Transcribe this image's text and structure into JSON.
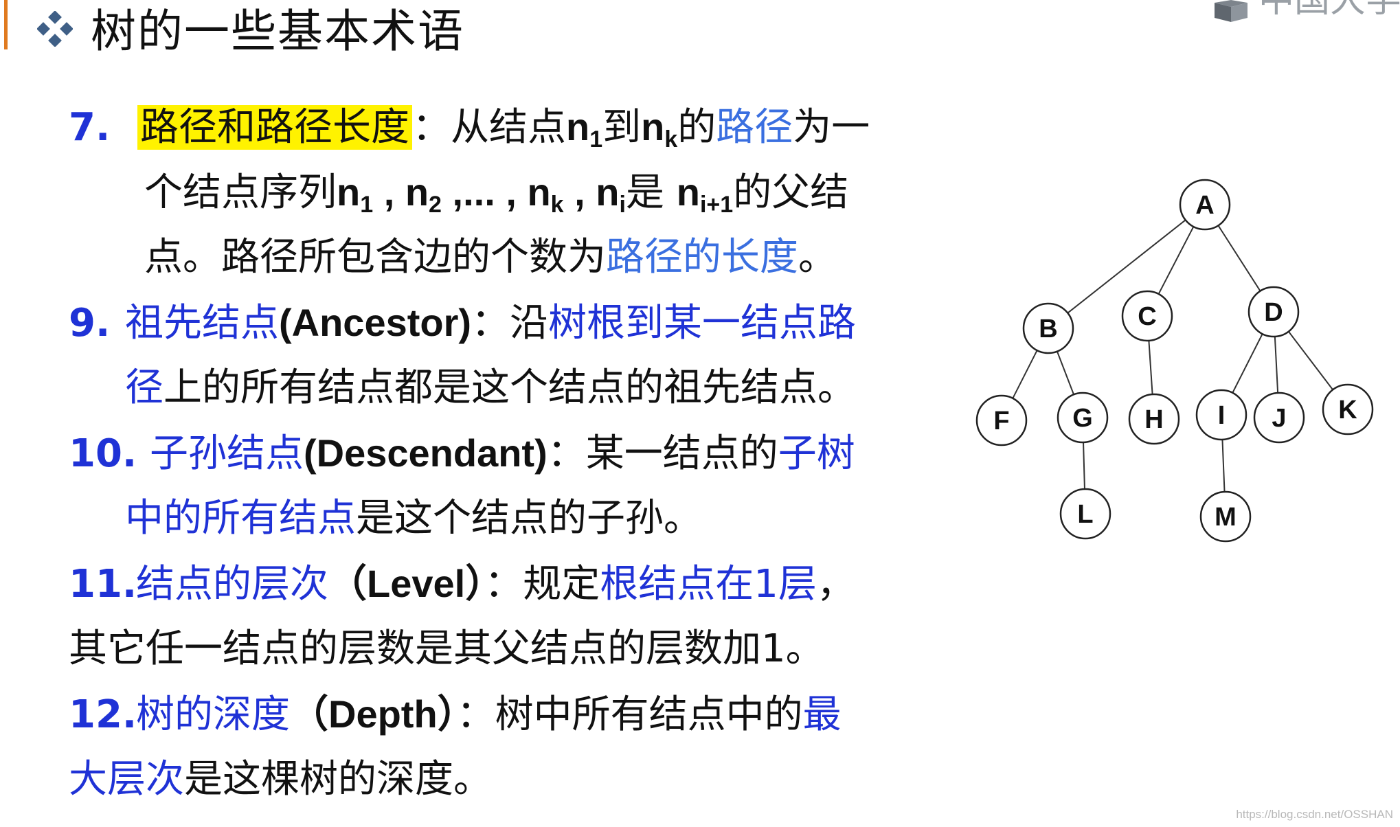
{
  "slide": {
    "title": "树的一些基本术语",
    "watermark": "中国大学MOOC",
    "credit": "https://blog.csdn.net/OSSHAN"
  },
  "terms": {
    "t7": {
      "num": "7.",
      "term": "路径和路径长度",
      "colon": "：",
      "l1_a": "从结点",
      "n1": "n",
      "n1_sub": "1",
      "to": "到",
      "nk": "n",
      "nk_sub": "k",
      "of": "的",
      "path": "路径",
      "l1_b": "为一",
      "l2_a": "个结点序列",
      "s1": "n",
      "s1_sub": "1",
      "sep1": " , ",
      "s2": "n",
      "s2_sub": "2",
      "sep2": " ,... , ",
      "s3": "n",
      "s3_sub": "k",
      "sep3": " , ",
      "s4": "n",
      "s4_sub": "i",
      "is": "是 ",
      "s5": "n",
      "s5_sub": "i+1",
      "l2_b": "的父结",
      "l3_a": "点。路径所包含边的个数为",
      "path_len": "路径的长度",
      "l3_b": "。"
    },
    "t9": {
      "num": "9.",
      "term": "祖先结点",
      "en": "(Ancestor)",
      "colon": "：",
      "l1_a": "沿",
      "l1_b": "树根到某一结点路",
      "l2_a": "径",
      "l2_b": "上的所有结点都是这个结点的祖先结点。"
    },
    "t10": {
      "num": "10.",
      "term": "子孙结点",
      "en": "(Descendant)",
      "colon": "：",
      "l1_a": "某一结点的",
      "l1_b": "子树",
      "l2_a": "中的所有结点",
      "l2_b": "是这个结点的子孙。"
    },
    "t11": {
      "num": "11.",
      "term": "结点的层次",
      "en": "（Level）",
      "colon": "：",
      "l1_a": "规定",
      "l1_b": "根结点在1层",
      "l1_c": "，",
      "l2": "其它任一结点的层数是其父结点的层数加1。"
    },
    "t12": {
      "num": "12.",
      "term": "树的深度",
      "en": "（Depth）",
      "colon": "：",
      "l1_a": "树中所有结点中的",
      "l1_b": "最",
      "l2_a": "大层次",
      "l2_b": "是这棵树的深度。"
    }
  },
  "tree": {
    "nodes": [
      {
        "id": "A",
        "label": "A",
        "parent": null,
        "level": 1
      },
      {
        "id": "B",
        "label": "B",
        "parent": "A",
        "level": 2
      },
      {
        "id": "C",
        "label": "C",
        "parent": "A",
        "level": 2
      },
      {
        "id": "D",
        "label": "D",
        "parent": "A",
        "level": 2
      },
      {
        "id": "F",
        "label": "F",
        "parent": "B",
        "level": 3
      },
      {
        "id": "G",
        "label": "G",
        "parent": "B",
        "level": 3
      },
      {
        "id": "H",
        "label": "H",
        "parent": "C",
        "level": 3
      },
      {
        "id": "I",
        "label": "I",
        "parent": "D",
        "level": 3
      },
      {
        "id": "J",
        "label": "J",
        "parent": "D",
        "level": 3
      },
      {
        "id": "K",
        "label": "K",
        "parent": "D",
        "level": 3
      },
      {
        "id": "L",
        "label": "L",
        "parent": "G",
        "level": 4
      },
      {
        "id": "M",
        "label": "M",
        "parent": "I",
        "level": 4
      }
    ]
  }
}
